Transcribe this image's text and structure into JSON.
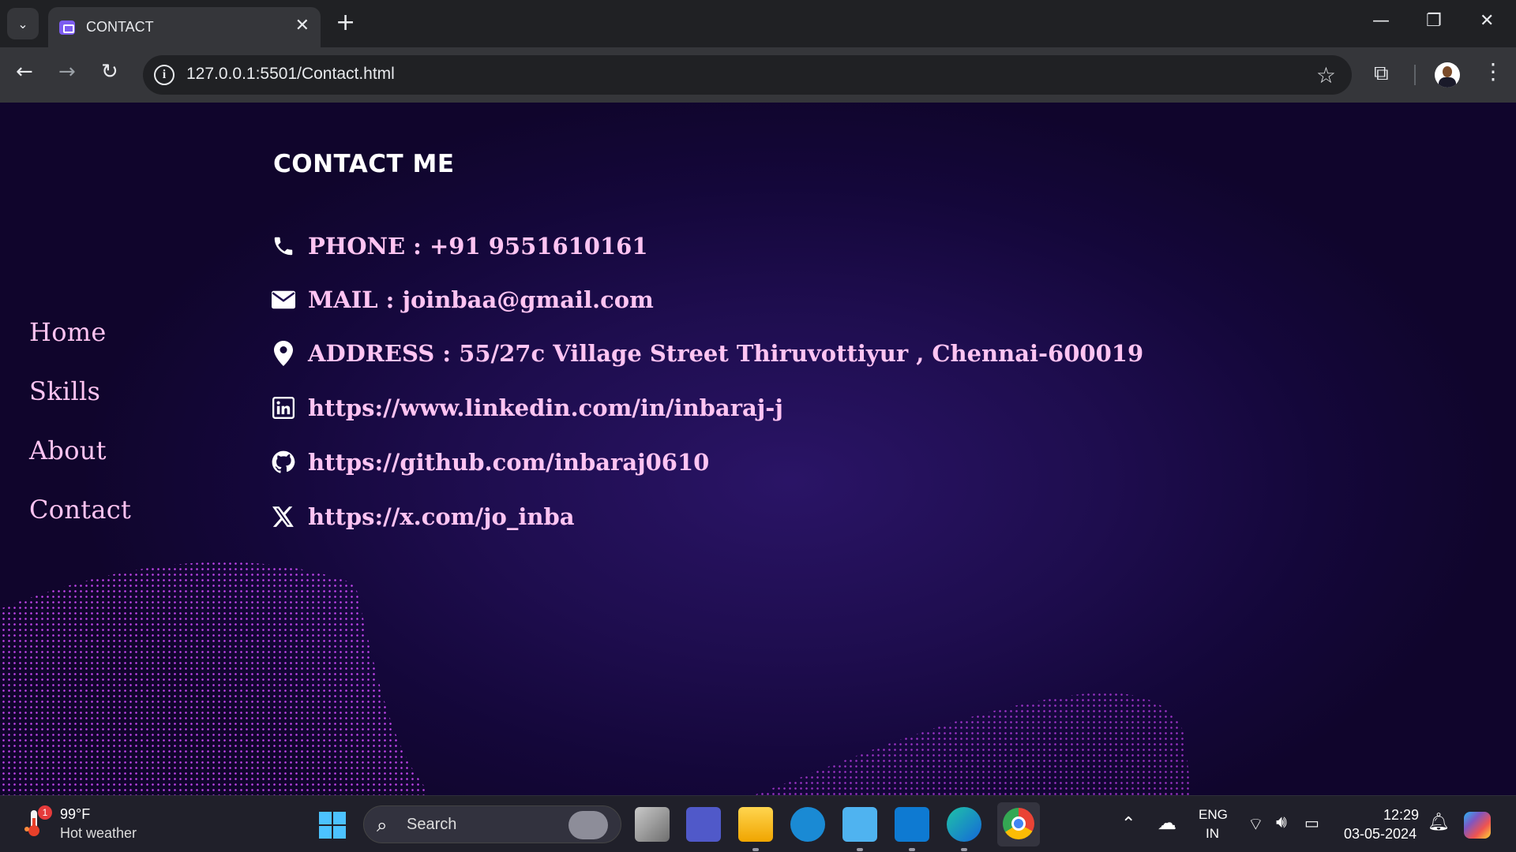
{
  "browser": {
    "tab_title": "CONTACT",
    "tab_close": "✕",
    "new_tab": "+",
    "url": "127.0.0.1:5501/Contact.html",
    "window": {
      "minimize": "—",
      "restore": "❐",
      "close": "✕"
    }
  },
  "nav": {
    "items": [
      {
        "label": "Home"
      },
      {
        "label": "Skills"
      },
      {
        "label": "About"
      },
      {
        "label": "Contact"
      }
    ]
  },
  "contact": {
    "heading": "CONTACT ME",
    "phone": "PHONE : +91 9551610161",
    "mail": "MAIL : joinbaa@gmail.com",
    "address": "ADDRESS : 55/27c Village Street Thiruvottiyur , Chennai-600019",
    "linkedin": "https://www.linkedin.com/in/inbaraj-j",
    "github": "https://github.com/inbaraj0610",
    "x": "https://x.com/jo_inba"
  },
  "taskbar": {
    "weather_temp": "99°F",
    "weather_desc": "Hot weather",
    "weather_badge": "1",
    "search_label": "Search",
    "lang_top": "ENG",
    "lang_bottom": "IN",
    "time": "12:29",
    "date": "03-05-2024"
  },
  "colors": {
    "accent_text": "#ffc4f2",
    "dots": "#d34bff",
    "page_bg": "#1e0d4e"
  }
}
